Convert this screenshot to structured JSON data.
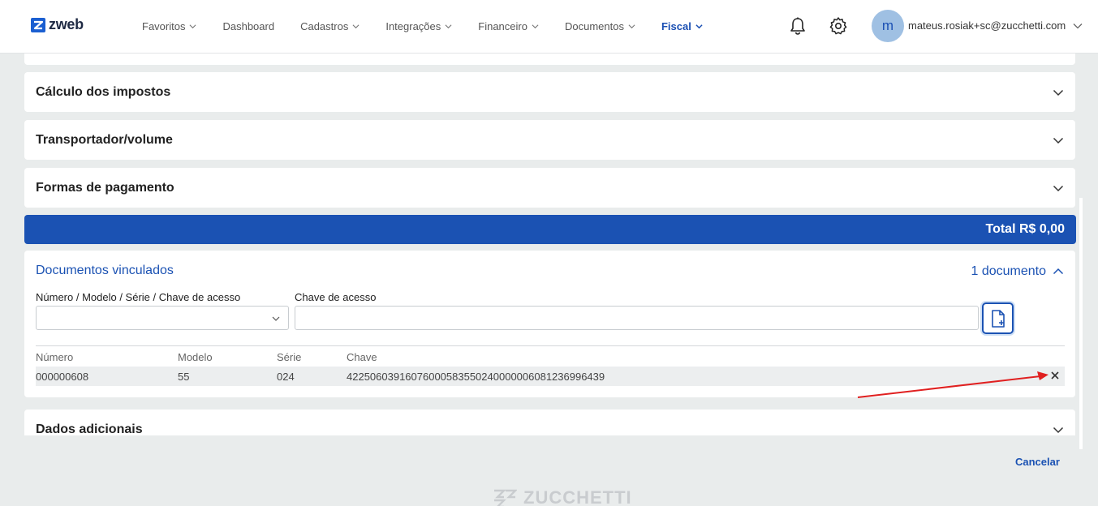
{
  "app": {
    "logo_text": "zweb",
    "brand_color": "#1b52b3"
  },
  "nav": {
    "items": [
      {
        "label": "Favoritos",
        "has_dropdown": true
      },
      {
        "label": "Dashboard",
        "has_dropdown": false
      },
      {
        "label": "Cadastros",
        "has_dropdown": true
      },
      {
        "label": "Integrações",
        "has_dropdown": true
      },
      {
        "label": "Financeiro",
        "has_dropdown": true
      },
      {
        "label": "Documentos",
        "has_dropdown": true
      },
      {
        "label": "Fiscal",
        "has_dropdown": true,
        "active": true
      }
    ]
  },
  "user": {
    "avatar_initial": "m",
    "email": "mateus.rosiak+sc@zucchetti.com"
  },
  "icons": {
    "notifications": "bell-icon",
    "settings": "gear-icon"
  },
  "sections": {
    "calculo": "Cálculo dos impostos",
    "transportador": "Transportador/volume",
    "pagamento": "Formas de pagamento",
    "adicionais": "Dados adicionais"
  },
  "total": {
    "label": "Total R$ 0,00"
  },
  "documentos": {
    "title": "Documentos vinculados",
    "count_label": "1 documento",
    "select_label": "Número / Modelo / Série / Chave de acesso",
    "select_value": "",
    "chave_label": "Chave de acesso",
    "chave_value": "",
    "columns": [
      "Número",
      "Modelo",
      "Série",
      "Chave"
    ],
    "rows": [
      {
        "numero": "000000608",
        "modelo": "55",
        "serie": "024",
        "chave": "42250603916076000583550240000006081236996439"
      }
    ]
  },
  "actions": {
    "cancel": "Cancelar"
  },
  "footer": {
    "logo_text": "ZUCCHETTI"
  }
}
